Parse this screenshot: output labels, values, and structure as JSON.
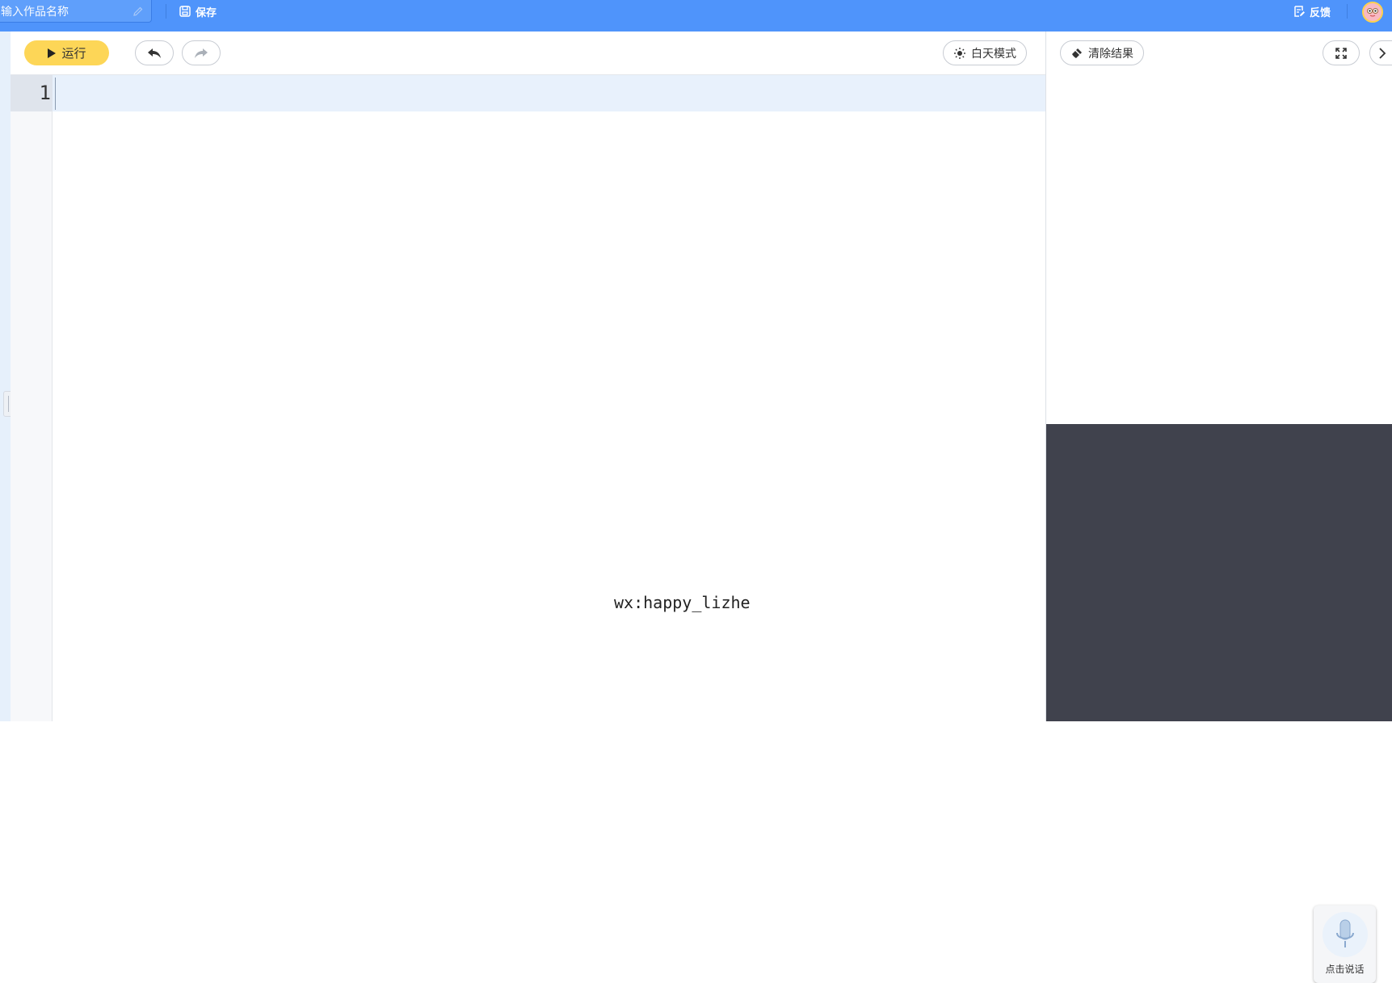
{
  "header": {
    "title_placeholder": "输入作品名称",
    "save_label": "保存",
    "feedback_label": "反馈"
  },
  "toolbar": {
    "run_label": "运行",
    "theme_label": "白天模式"
  },
  "editor": {
    "line_number": "1",
    "watermark": "wx:happy_lizhe"
  },
  "output": {
    "clear_label": "清除结果",
    "mic_label": "点击说话"
  },
  "colors": {
    "topbar": "#4f94fb",
    "run_button": "#fdd657",
    "stage_bg": "#40424d",
    "active_line": "#e8f1fc"
  }
}
